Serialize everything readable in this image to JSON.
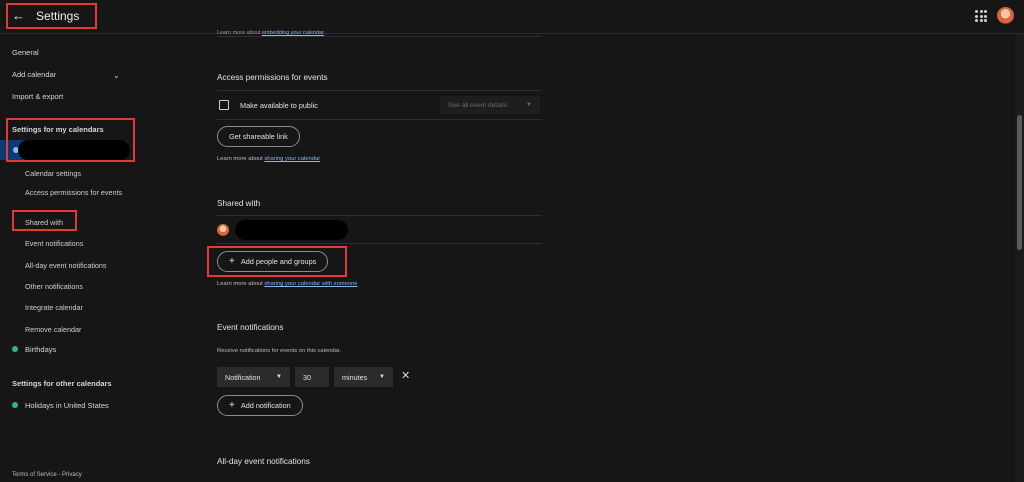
{
  "header": {
    "back_icon": "arrow-left-icon",
    "title": "Settings",
    "apps_icon": "grid-apps-icon"
  },
  "sidebar": {
    "general": "General",
    "add_calendar": "Add calendar",
    "import_export": "Import & export",
    "my_calendars_heading": "Settings for my calendars",
    "calendar_items": [
      "Calendar settings",
      "Access permissions for events",
      "Shared with",
      "Event notifications",
      "All-day event notifications",
      "Other notifications",
      "Integrate calendar",
      "Remove calendar"
    ],
    "birthdays": "Birthdays",
    "other_calendars_heading": "Settings for other calendars",
    "holidays": "Holidays in United States",
    "terms": "Terms of Service",
    "separator": "-",
    "privacy": "Privacy"
  },
  "main": {
    "top_faint_prefix": "Learn more about",
    "top_faint_link": "embedding your calendar",
    "access": {
      "title": "Access permissions for events",
      "make_public": "Make available to public",
      "visibility_select": "See all event details",
      "shareable_link_button": "Get shareable link",
      "learn_prefix": "Learn more about",
      "learn_link": "sharing your calendar"
    },
    "shared": {
      "title": "Shared with",
      "add_button": "Add people and groups",
      "learn_prefix": "Learn more about",
      "learn_link": "sharing your calendar with someone"
    },
    "notifications": {
      "title": "Event notifications",
      "description": "Receive notifications for events on this calendar.",
      "type": "Notification",
      "amount": "30",
      "unit": "minutes",
      "add_button": "Add notification"
    },
    "allday_title": "All-day event notifications"
  },
  "colors": {
    "accent_blue": "#1a73e8",
    "link_blue": "#8ab4f8",
    "calendar_green": "#33b679",
    "annotation_red": "#e53935"
  }
}
